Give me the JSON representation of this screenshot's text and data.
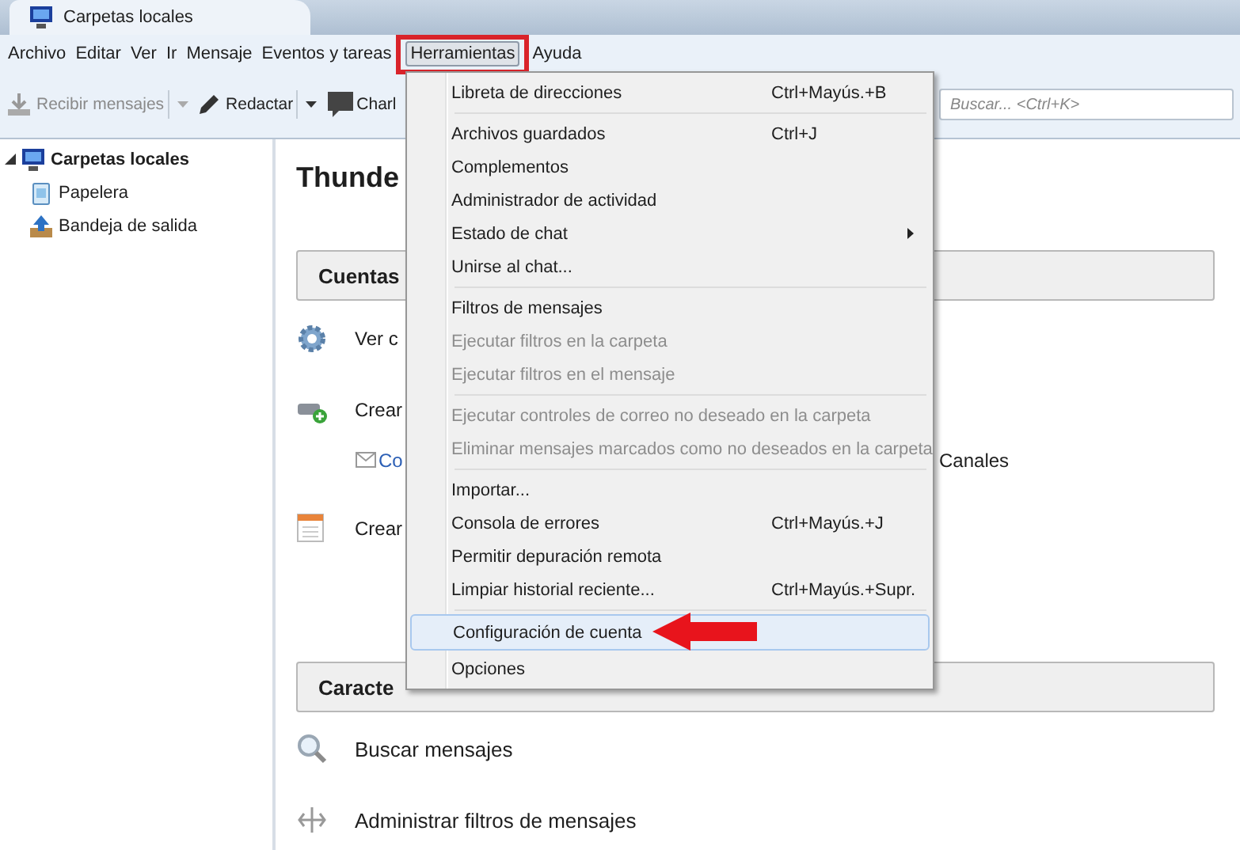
{
  "window": {
    "title": "Carpetas locales"
  },
  "menubar": [
    {
      "label": "Archivo",
      "selected": false,
      "callout": false
    },
    {
      "label": "Editar",
      "selected": false,
      "callout": false
    },
    {
      "label": "Ver",
      "selected": false,
      "callout": false
    },
    {
      "label": "Ir",
      "selected": false,
      "callout": false
    },
    {
      "label": "Mensaje",
      "selected": false,
      "callout": false
    },
    {
      "label": "Eventos y tareas",
      "selected": false,
      "callout": false
    },
    {
      "label": "Herramientas",
      "selected": true,
      "callout": true
    },
    {
      "label": "Ayuda",
      "selected": false,
      "callout": false
    }
  ],
  "toolbar": [
    {
      "label": "Recibir mensajes",
      "kind": "get",
      "disabled": true,
      "dropdown": true
    },
    {
      "label": "Redactar",
      "kind": "write",
      "disabled": false,
      "dropdown": true
    },
    {
      "label": "Charl",
      "kind": "chat",
      "disabled": false,
      "dropdown": false
    }
  ],
  "search": {
    "placeholder": "Buscar... <Ctrl+K>"
  },
  "sidebar": {
    "items": [
      {
        "label": "Carpetas locales",
        "kind": "local",
        "expanded": true,
        "children": [
          {
            "label": "Papelera",
            "kind": "trash"
          },
          {
            "label": "Bandeja de salida",
            "kind": "outbox"
          }
        ]
      }
    ]
  },
  "content": {
    "title": "Thunde",
    "sections": [
      {
        "heading": "Cuentas",
        "rows": [
          {
            "kind": "gear",
            "label": "Ver c"
          },
          {
            "kind": "newaccount",
            "label": "Crear"
          },
          {
            "kind": "links",
            "label": "Co",
            "extra": "Canales"
          },
          {
            "kind": "calendar",
            "label": "Crear"
          }
        ]
      },
      {
        "heading": "Caracte",
        "rows": [
          {
            "kind": "search",
            "label": "Buscar mensajes"
          },
          {
            "kind": "filter",
            "label": "Administrar filtros de mensajes"
          }
        ]
      }
    ]
  },
  "menu": {
    "groups": [
      [
        {
          "label": "Libreta de direcciones",
          "shortcut": "Ctrl+Mayús.+B",
          "disabled": false,
          "submenu": false,
          "selected": false,
          "arrow": false
        }
      ],
      [
        {
          "label": "Archivos guardados",
          "shortcut": "Ctrl+J",
          "disabled": false,
          "submenu": false,
          "selected": false,
          "arrow": false
        },
        {
          "label": "Complementos",
          "disabled": false,
          "submenu": false,
          "selected": false,
          "arrow": false
        },
        {
          "label": "Administrador de actividad",
          "disabled": false,
          "submenu": false,
          "selected": false,
          "arrow": false
        },
        {
          "label": "Estado de chat",
          "disabled": false,
          "submenu": true,
          "selected": false,
          "arrow": false
        },
        {
          "label": "Unirse al chat...",
          "disabled": false,
          "submenu": false,
          "selected": false,
          "arrow": false
        }
      ],
      [
        {
          "label": "Filtros de mensajes",
          "disabled": false,
          "submenu": false,
          "selected": false,
          "arrow": false
        },
        {
          "label": "Ejecutar filtros en la carpeta",
          "disabled": true,
          "submenu": false,
          "selected": false,
          "arrow": false
        },
        {
          "label": "Ejecutar filtros en el mensaje",
          "disabled": true,
          "submenu": false,
          "selected": false,
          "arrow": false
        }
      ],
      [
        {
          "label": "Ejecutar controles de correo no deseado en la carpeta",
          "disabled": true,
          "submenu": false,
          "selected": false,
          "arrow": false
        },
        {
          "label": "Eliminar mensajes marcados como no deseados en la carpeta",
          "disabled": true,
          "submenu": false,
          "selected": false,
          "arrow": false
        }
      ],
      [
        {
          "label": "Importar...",
          "disabled": false,
          "submenu": false,
          "selected": false,
          "arrow": false
        },
        {
          "label": "Consola de errores",
          "shortcut": "Ctrl+Mayús.+J",
          "disabled": false,
          "submenu": false,
          "selected": false,
          "arrow": false
        },
        {
          "label": "Permitir depuración remota",
          "disabled": false,
          "submenu": false,
          "selected": false,
          "arrow": false
        },
        {
          "label": "Limpiar historial reciente...",
          "shortcut": "Ctrl+Mayús.+Supr.",
          "disabled": false,
          "submenu": false,
          "selected": false,
          "arrow": false
        }
      ],
      [
        {
          "label": "Configuración de cuenta",
          "disabled": false,
          "submenu": false,
          "selected": true,
          "arrow": true
        },
        {
          "label": "Opciones",
          "disabled": false,
          "submenu": false,
          "selected": false,
          "arrow": false
        }
      ]
    ]
  }
}
